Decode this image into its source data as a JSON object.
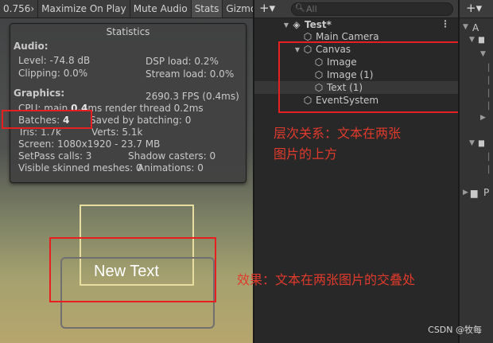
{
  "game_toolbar": {
    "items": [
      "0.756›",
      "Maximize On Play",
      "Mute Audio",
      "Stats",
      "Gizmos"
    ]
  },
  "stats": {
    "title": "Statistics",
    "audio_header": "Audio:",
    "level": "Level: -74.8 dB",
    "dsp_load": "DSP load: 0.2%",
    "clipping": "Clipping: 0.0%",
    "stream_load": "Stream load: 0.0%",
    "graphics_header": "Graphics:",
    "fps": "2690.3 FPS (0.4ms)",
    "cpu_prefix": "CPU: main ",
    "cpu_main": "0.4",
    "cpu_suffix": "ms  render thread 0.2ms",
    "batches_prefix": "Batches: ",
    "batches_value": "4",
    "saved_by_batching": "Saved by batching: 0",
    "tris": "Tris: 1.7k",
    "verts": "Verts: 5.1k",
    "screen": "Screen: 1080x1920 - 23.7 MB",
    "setpass": "SetPass calls: 3",
    "shadow_casters": "Shadow casters: 0",
    "skinned_meshes": "Visible skinned meshes: 0",
    "animations": "Animations: 0"
  },
  "game": {
    "text_label": "New Text"
  },
  "hierarchy": {
    "add_label": "+▾",
    "search_placeholder": "All",
    "scene": "Test*",
    "items": [
      "Main Camera",
      "Canvas",
      "Image",
      "Image (1)",
      "Text (1)",
      "EventSystem"
    ]
  },
  "annotations": {
    "hierarchy_note_line1": "层次关系：文本在两张",
    "hierarchy_note_line2": "图片的上方",
    "effect_note": "效果：文本在两张图片的交叠处"
  },
  "project": {
    "add_label": "+▾",
    "letters": [
      "A",
      "P"
    ]
  },
  "watermark": "CSDN @牧每",
  "colors": {
    "annotation_red": "#e62020",
    "annotation_text": "#e03a2c",
    "frame_yellow": "#e8dda0",
    "frame_gray": "#707070"
  }
}
